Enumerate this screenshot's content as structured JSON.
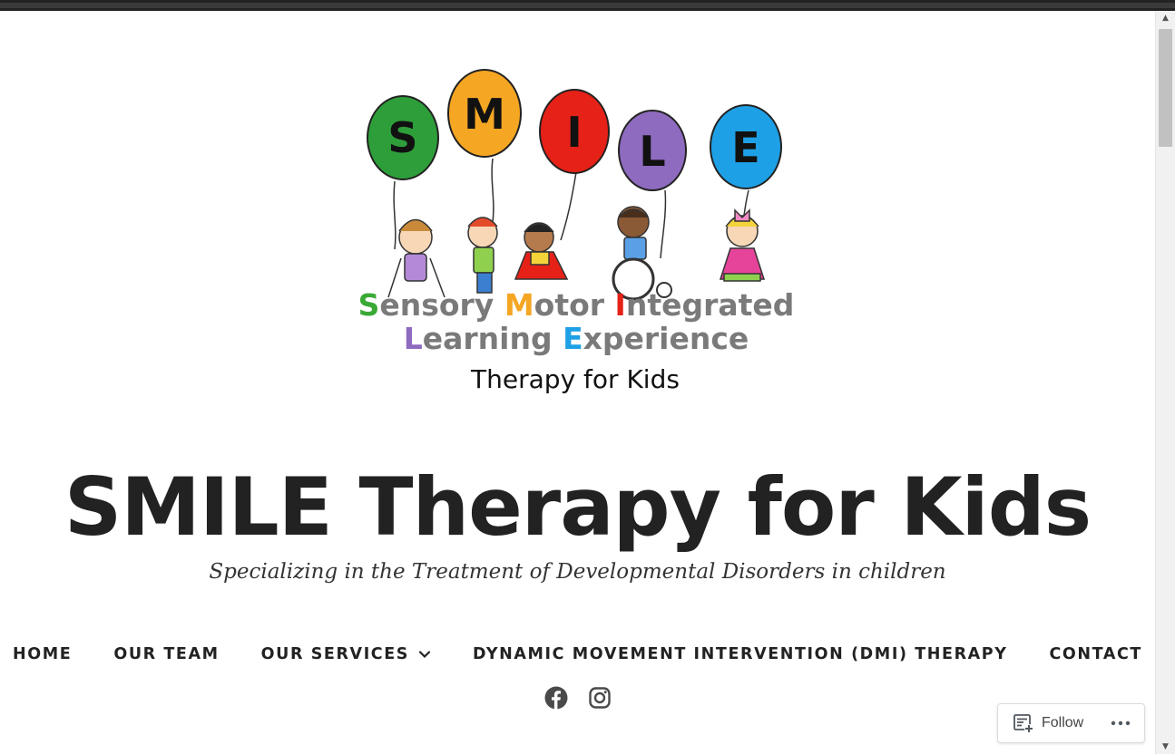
{
  "logo": {
    "balloon_letters": [
      "S",
      "M",
      "I",
      "L",
      "E"
    ],
    "balloon_colors": [
      "#2e9e3a",
      "#f5a623",
      "#e62117",
      "#8e6bbf",
      "#1ea0e6"
    ],
    "acronym_line1": [
      {
        "initial": "S",
        "rest": "ensory ",
        "color": "#3aa935"
      },
      {
        "initial": "M",
        "rest": "otor ",
        "color": "#f5a623"
      },
      {
        "initial": "I",
        "rest": "ntegrated",
        "color": "#e62117"
      }
    ],
    "acronym_line2": [
      {
        "initial": "L",
        "rest": "earning ",
        "color": "#8e6bbf"
      },
      {
        "initial": "E",
        "rest": "xperience",
        "color": "#1ea0e6"
      }
    ],
    "subtitle": "Therapy for Kids"
  },
  "site": {
    "title": "SMILE Therapy for Kids",
    "tagline": "Specializing in the Treatment of Developmental Disorders in children"
  },
  "nav": {
    "items": [
      {
        "label": "HOME"
      },
      {
        "label": "OUR TEAM"
      },
      {
        "label": "OUR SERVICES",
        "has_dropdown": true
      },
      {
        "label": "DYNAMIC MOVEMENT INTERVENTION (DMI) THERAPY"
      },
      {
        "label": "CONTACT"
      }
    ]
  },
  "social": {
    "icons": [
      "facebook-icon",
      "instagram-icon"
    ]
  },
  "follow_widget": {
    "label": "Follow",
    "icon": "reader-follow-icon",
    "more_icon": "ellipsis-icon"
  },
  "colors": {
    "text_dark": "#222222",
    "gray_text": "#7a7a7a",
    "top_bar": "#222222"
  }
}
